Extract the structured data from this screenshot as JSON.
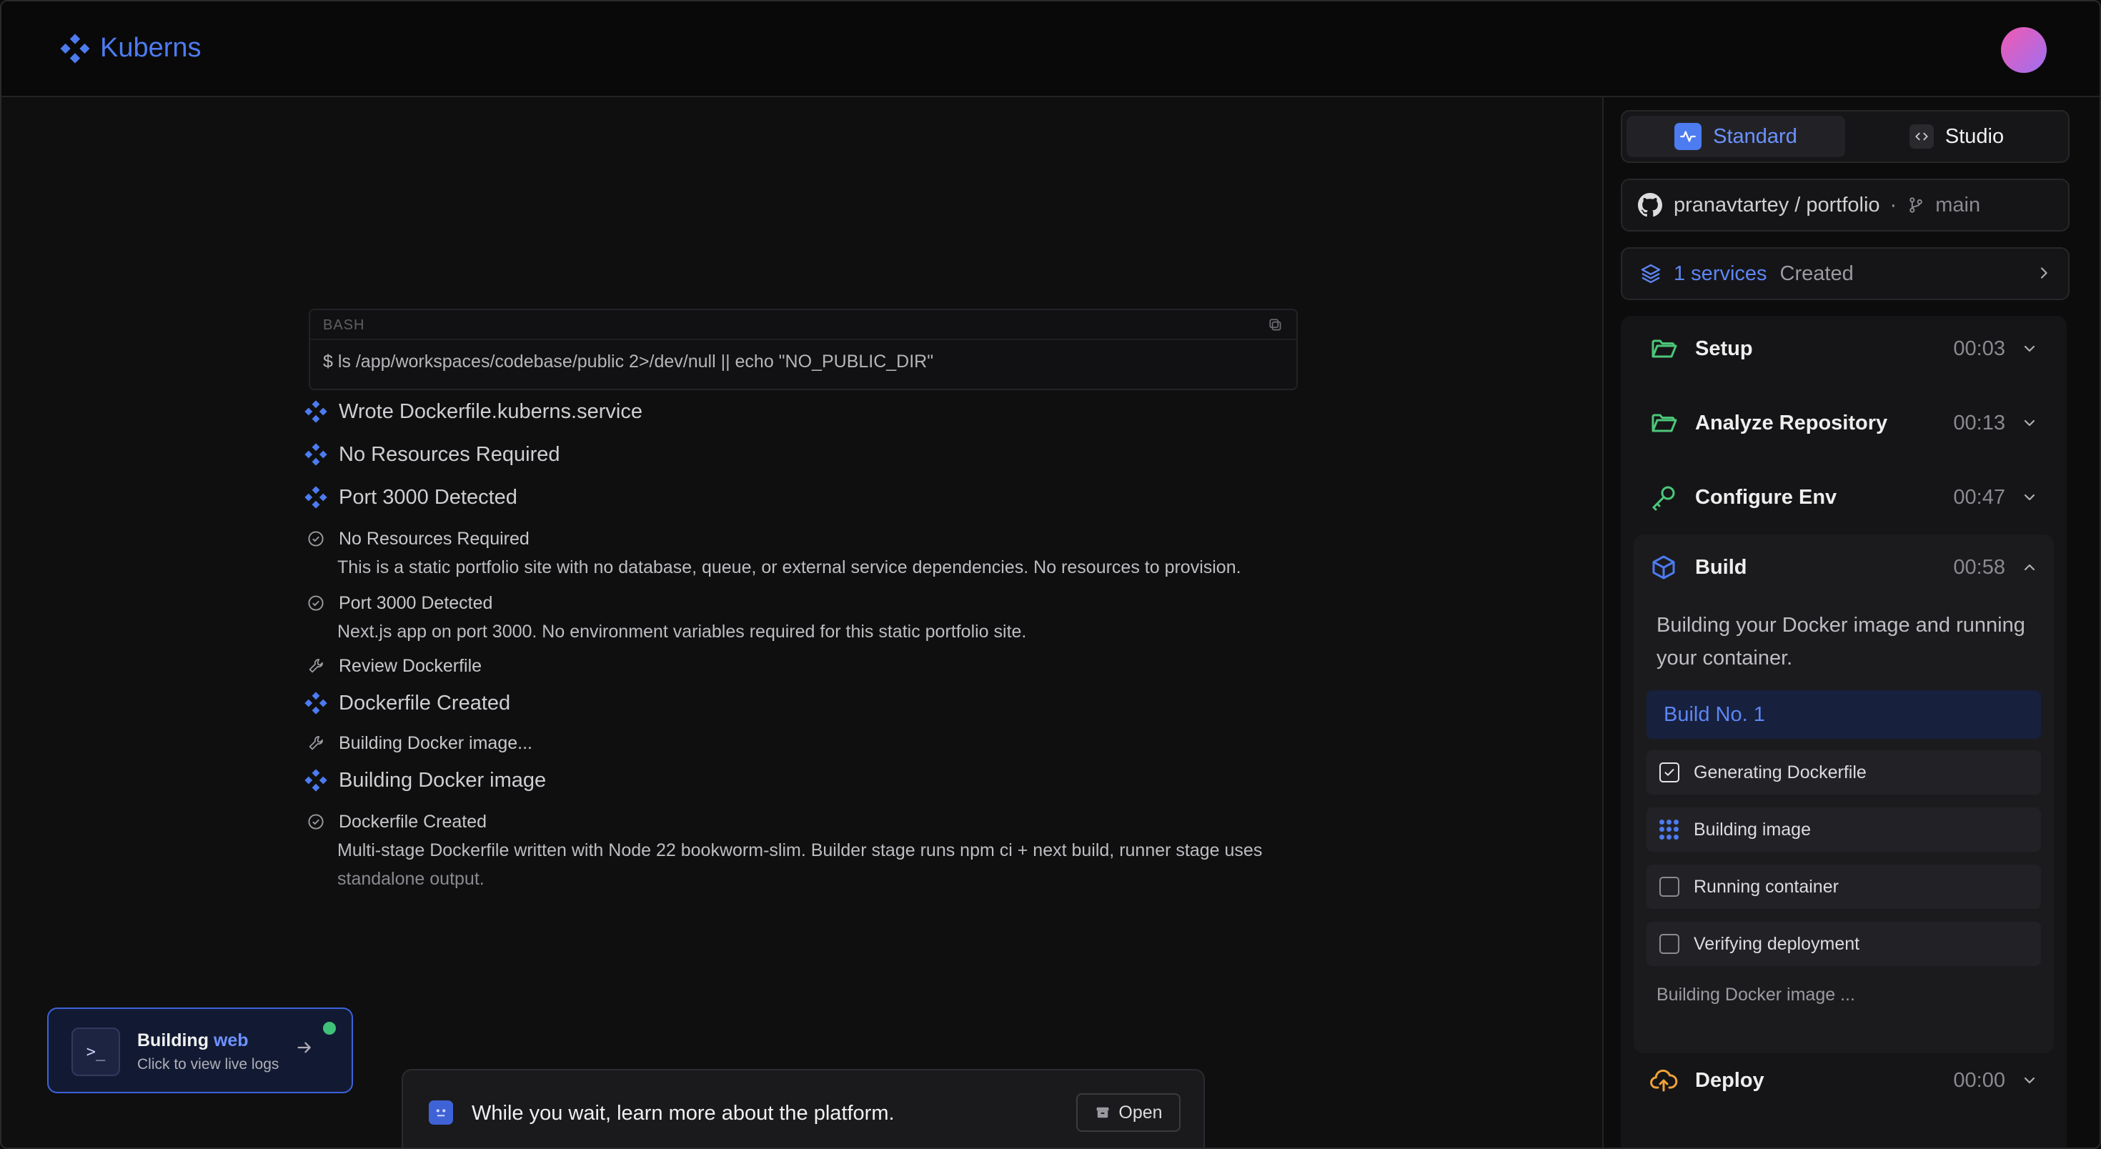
{
  "app": {
    "name": "Kuberns"
  },
  "bash": {
    "label": "BASH",
    "command": "$ ls /app/workspaces/codebase/public 2>/dev/null || echo \"NO_PUBLIC_DIR\""
  },
  "feed": {
    "items": [
      {
        "kind": "event",
        "icon": "kuberns-diamond-icon",
        "text": "Wrote Dockerfile.kuberns.service"
      },
      {
        "kind": "event",
        "icon": "kuberns-diamond-icon",
        "text": "No Resources Required"
      },
      {
        "kind": "event",
        "icon": "kuberns-diamond-icon",
        "text": "Port 3000 Detected"
      },
      {
        "kind": "check",
        "icon": "check-circle-icon",
        "text": "No Resources Required",
        "desc": "This is a static portfolio site with no database, queue, or external service dependencies. No resources to provision."
      },
      {
        "kind": "check",
        "icon": "check-circle-icon",
        "text": "Port 3000 Detected",
        "desc": "Next.js app on port 3000. No environment variables required for this static portfolio site."
      },
      {
        "kind": "tool",
        "icon": "wrench-icon",
        "text": "Review Dockerfile"
      },
      {
        "kind": "event",
        "icon": "kuberns-diamond-icon",
        "text": "Dockerfile Created"
      },
      {
        "kind": "tool",
        "icon": "wrench-icon",
        "text": "Building Docker image..."
      },
      {
        "kind": "event",
        "icon": "kuberns-diamond-icon",
        "text": "Building Docker image"
      },
      {
        "kind": "check",
        "icon": "check-circle-icon",
        "text": "Dockerfile Created",
        "desc": "Multi-stage Dockerfile written with Node 22 bookworm-slim. Builder stage runs npm ci + next build, runner stage uses",
        "desc_faded": "standalone output."
      }
    ]
  },
  "build_card": {
    "title_prefix": "Building",
    "title_service": "web",
    "subtitle": "Click to view live logs",
    "status_color": "#3fc17a"
  },
  "wait_bar": {
    "text": "While you wait, learn more about the platform.",
    "open_label": "Open"
  },
  "sidebar": {
    "mode_toggle": {
      "standard": "Standard",
      "studio": "Studio",
      "active": "Standard"
    },
    "repo": {
      "owner_repo": "pranavtartey / portfolio",
      "separator": "·",
      "branch": "main"
    },
    "services": {
      "count_label": "1 services",
      "status": "Created"
    },
    "steps": [
      {
        "name": "Setup",
        "time": "00:03",
        "icon": "folder-open-icon",
        "color": "#4cc77a",
        "expanded": false
      },
      {
        "name": "Analyze Repository",
        "time": "00:13",
        "icon": "folder-open-icon",
        "color": "#4cc77a",
        "expanded": false
      },
      {
        "name": "Configure Env",
        "time": "00:47",
        "icon": "key-icon",
        "color": "#4cc77a",
        "expanded": false
      },
      {
        "name": "Build",
        "time": "00:58",
        "icon": "box-icon",
        "color": "#4d7bf0",
        "expanded": true
      },
      {
        "name": "Deploy",
        "time": "00:00",
        "icon": "cloud-upload-icon",
        "color": "#f0a23a",
        "expanded": false
      }
    ],
    "build": {
      "description": "Building your Docker image and running your container.",
      "build_no": "Build No. 1",
      "tasks": [
        {
          "label": "Generating Dockerfile",
          "state": "done"
        },
        {
          "label": "Building image",
          "state": "in-progress"
        },
        {
          "label": "Running container",
          "state": "pending"
        },
        {
          "label": "Verifying deployment",
          "state": "pending"
        }
      ],
      "status": "Building Docker image ..."
    }
  },
  "colors": {
    "accent": "#4d7bf0",
    "success": "#4cc77a",
    "warning": "#f0a23a"
  }
}
